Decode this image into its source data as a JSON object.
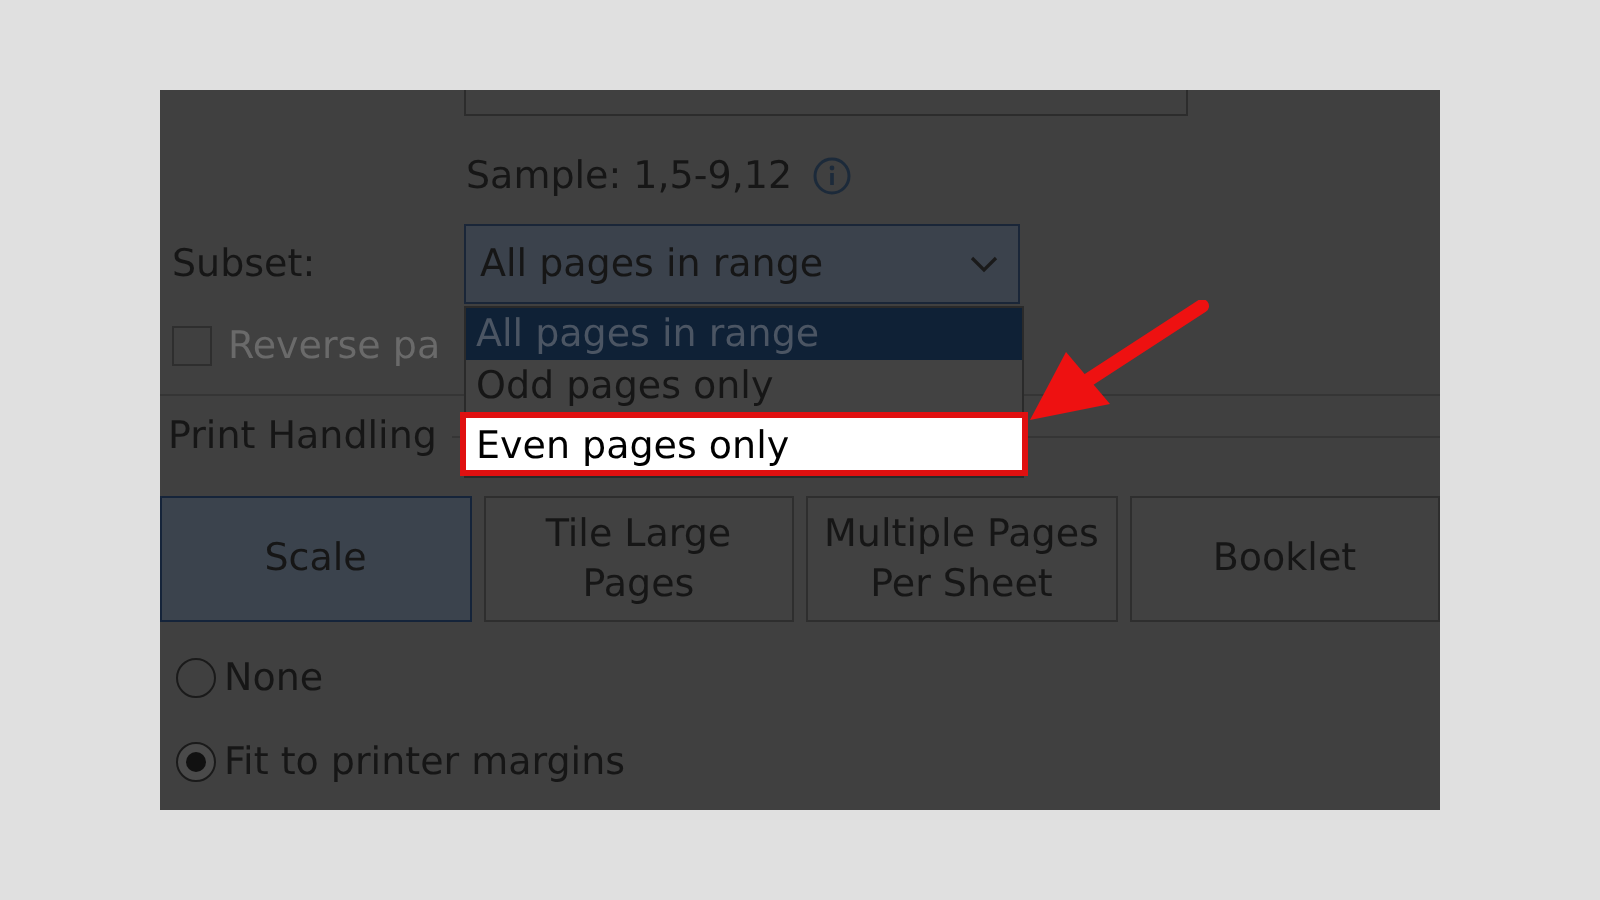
{
  "page_range": {
    "sample": "Sample: 1,5-9,12"
  },
  "subset": {
    "label": "Subset:",
    "value": "All pages in range",
    "options": [
      {
        "label": "All pages in range",
        "selected": true,
        "highlighted": false
      },
      {
        "label": "Odd pages only",
        "selected": false,
        "highlighted": false
      },
      {
        "label": "Even pages only",
        "selected": false,
        "highlighted": true
      }
    ]
  },
  "reverse_pages": {
    "label": "Reverse pa",
    "checked": false,
    "disabled": true
  },
  "print_handling": {
    "title": "Print Handling",
    "buttons": [
      {
        "label": "Scale",
        "selected": true
      },
      {
        "label": "Tile Large Pages",
        "selected": false
      },
      {
        "label": "Multiple Pages Per Sheet",
        "selected": false
      },
      {
        "label": "Booklet",
        "selected": false
      }
    ],
    "options": [
      {
        "label": "None",
        "selected": false
      },
      {
        "label": "Fit to printer margins",
        "selected": true
      }
    ]
  }
}
